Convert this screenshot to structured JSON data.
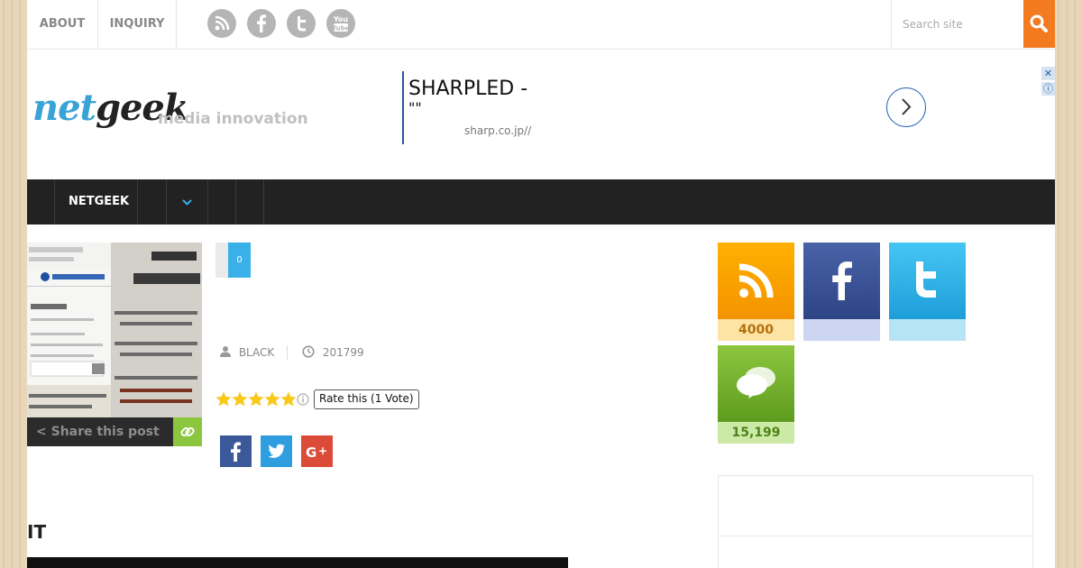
{
  "topbar": {
    "links": [
      "ABOUT",
      "INQUIRY"
    ],
    "social_icons": [
      "rss-icon",
      "facebook-icon",
      "twitter-icon",
      "youtube-icon"
    ],
    "search_placeholder": "Search site"
  },
  "header": {
    "logo_part1": "net",
    "logo_part2": "geek",
    "tagline": "media innovation"
  },
  "ad": {
    "title": "SHARPLED -",
    "subtitle": "\"\"",
    "url": "sharp.co.jp//"
  },
  "nav": {
    "items": [
      "NETGEEK"
    ]
  },
  "post": {
    "share_label": "Share this post",
    "comments_count": "0",
    "author": "BLACK",
    "date": "201799",
    "rating": 5,
    "rate_tooltip": "Rate this (1 Vote)",
    "share_buttons": [
      "facebook",
      "twitter",
      "google-plus"
    ],
    "heading": "IT"
  },
  "sidebar": {
    "tiles": [
      {
        "name": "rss",
        "count": "4000"
      },
      {
        "name": "facebook",
        "count": ""
      },
      {
        "name": "twitter",
        "count": ""
      },
      {
        "name": "comments",
        "count": "15,199"
      }
    ]
  },
  "colors": {
    "accent_orange": "#f47a20",
    "nav_bg": "#222222",
    "comment_blue": "#3ab0e8",
    "star_yellow": "#f7c919",
    "share_green": "#8cc63f"
  }
}
